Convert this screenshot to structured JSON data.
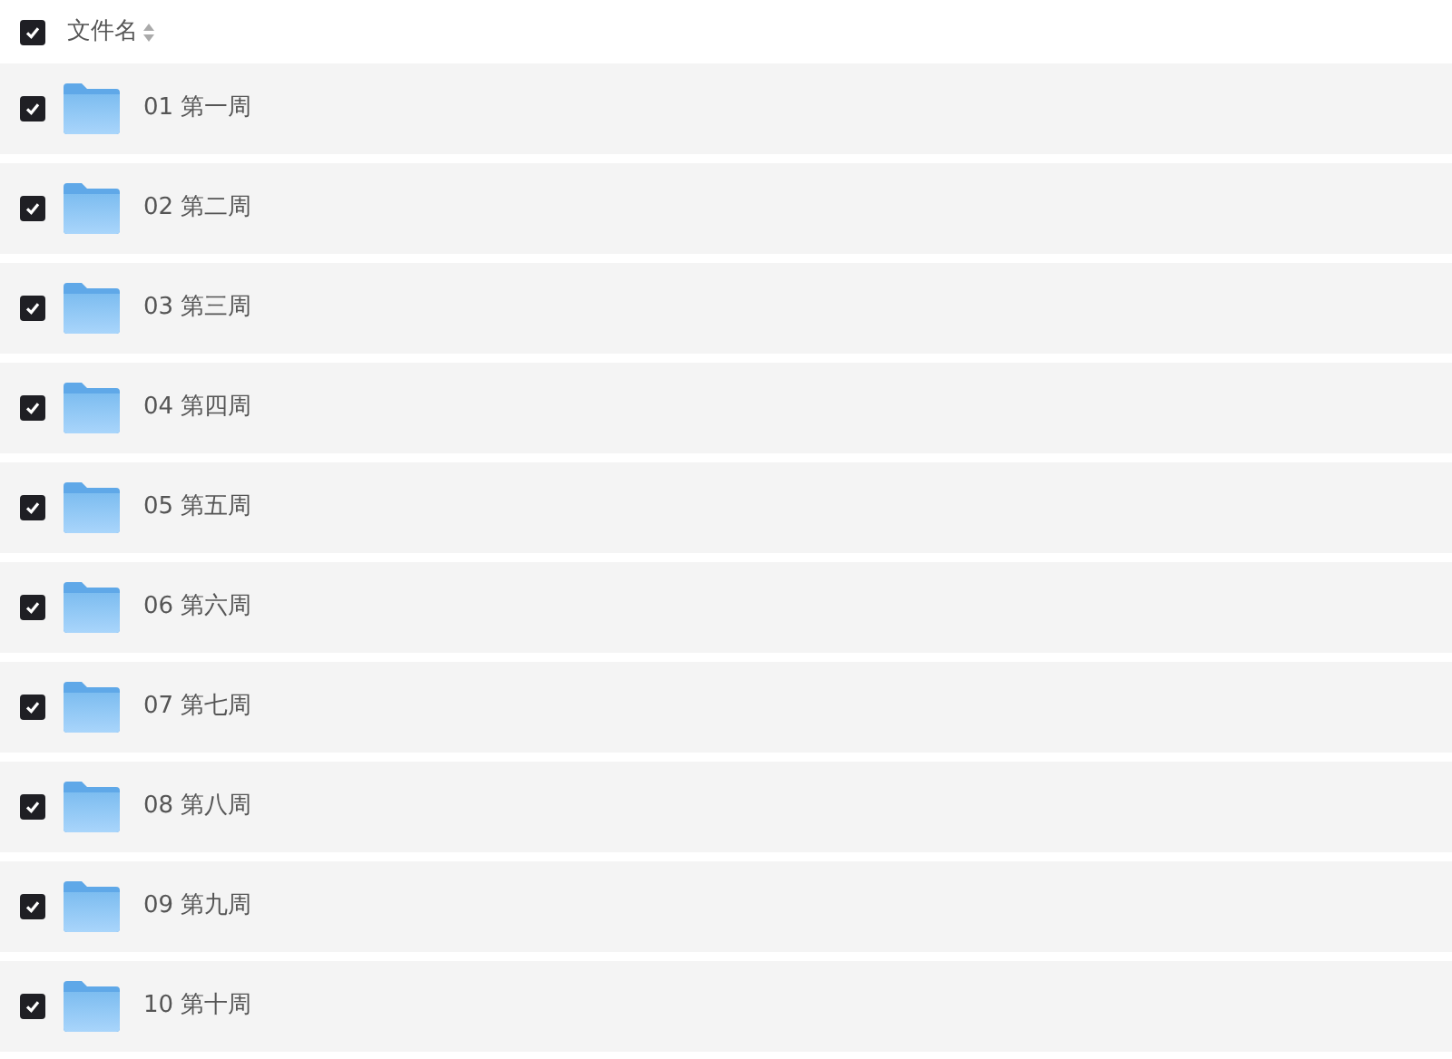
{
  "header": {
    "checked": true,
    "label": "文件名"
  },
  "rows": [
    {
      "name": "01 第一周",
      "checked": true
    },
    {
      "name": "02 第二周",
      "checked": true
    },
    {
      "name": "03 第三周",
      "checked": true
    },
    {
      "name": "04 第四周",
      "checked": true
    },
    {
      "name": "05 第五周",
      "checked": true
    },
    {
      "name": "06 第六周",
      "checked": true
    },
    {
      "name": "07 第七周",
      "checked": true
    },
    {
      "name": "08 第八周",
      "checked": true
    },
    {
      "name": "09 第九周",
      "checked": true
    },
    {
      "name": "10 第十周",
      "checked": true
    }
  ]
}
